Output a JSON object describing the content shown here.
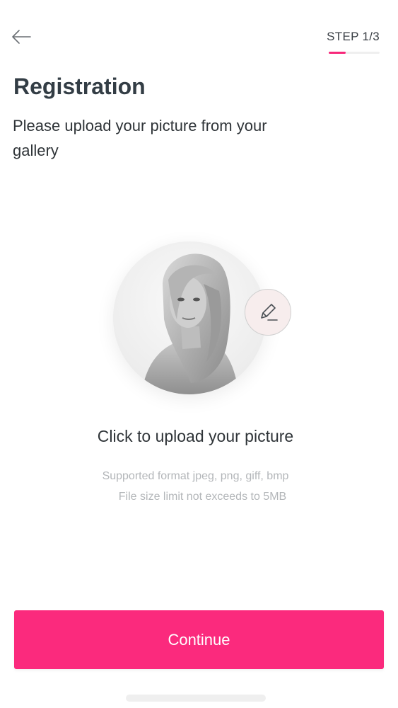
{
  "header": {
    "back_icon": "arrow-left-icon",
    "step_label": "STEP 1/3",
    "step_progress": 0.3333
  },
  "page": {
    "title": "Registration",
    "subtitle": "Please upload your picture from your gallery"
  },
  "upload": {
    "avatar_icon": "profile-photo",
    "edit_icon": "pencil-icon",
    "title": "Click to upload your picture",
    "hint_formats": "Supported format jpeg, png, giff, bmp",
    "hint_size": "File size limit not exceeds to 5MB"
  },
  "actions": {
    "continue_label": "Continue"
  },
  "colors": {
    "accent": "#fb2a7d",
    "title_text": "#333d45",
    "hint_text": "#b3b6b9"
  }
}
